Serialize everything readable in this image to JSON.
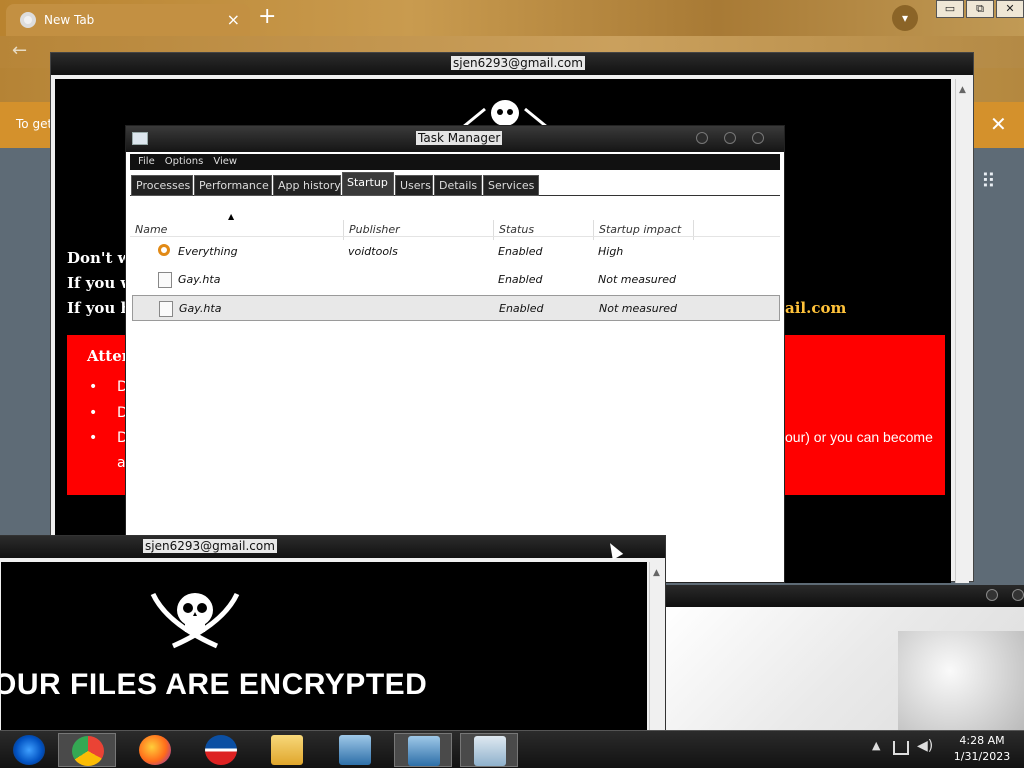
{
  "browser": {
    "tab_title": "New Tab",
    "tab_close": "×",
    "new_tab": "+",
    "infobar_text": "To get",
    "infobar_close": "✕",
    "window_controls": [
      "▭",
      "⧉",
      "✕"
    ]
  },
  "ransom_window_back": {
    "title": "sjen6293@gmail.com",
    "line1": "Don't wo",
    "line2": "If you w",
    "line3": "If you h",
    "email_fragment": "ail.com",
    "attention": "Atten",
    "bullets": [
      "D",
      "D",
      "D"
    ],
    "bullet_continuation": "a",
    "red_right_text": "our) or you can become"
  },
  "ransom_window_front": {
    "title": "sjen6293@gmail.com",
    "headline": "OUR FILES ARE ENCRYPTED"
  },
  "task_manager": {
    "title": "Task Manager",
    "menu": [
      "File",
      "Options",
      "View"
    ],
    "tabs": [
      "Processes",
      "Performance",
      "App history",
      "Startup",
      "Users",
      "Details",
      "Services"
    ],
    "active_tab": "Startup",
    "columns": [
      "Name",
      "Publisher",
      "Status",
      "Startup impact"
    ],
    "rows": [
      {
        "name": "Everything",
        "publisher": "voidtools",
        "status": "Enabled",
        "impact": "High",
        "icon": "key-icon"
      },
      {
        "name": "Gay.hta",
        "publisher": "",
        "status": "Enabled",
        "impact": "Not measured",
        "icon": "file-icon"
      },
      {
        "name": "Gay.hta",
        "publisher": "",
        "status": "Enabled",
        "impact": "Not measured",
        "icon": "file-icon",
        "selected": true
      }
    ]
  },
  "taskbar": {
    "items": [
      "start-orb",
      "chrome",
      "firefox",
      "obama-app",
      "file-explorer",
      "setup-installer",
      "setup-installer",
      "task-manager"
    ],
    "time": "4:28 AM",
    "date": "1/31/2023"
  },
  "colors": {
    "accent_orange": "#d4912c",
    "ransom_red": "#ff0000",
    "email_gold": "#ffc23a"
  }
}
